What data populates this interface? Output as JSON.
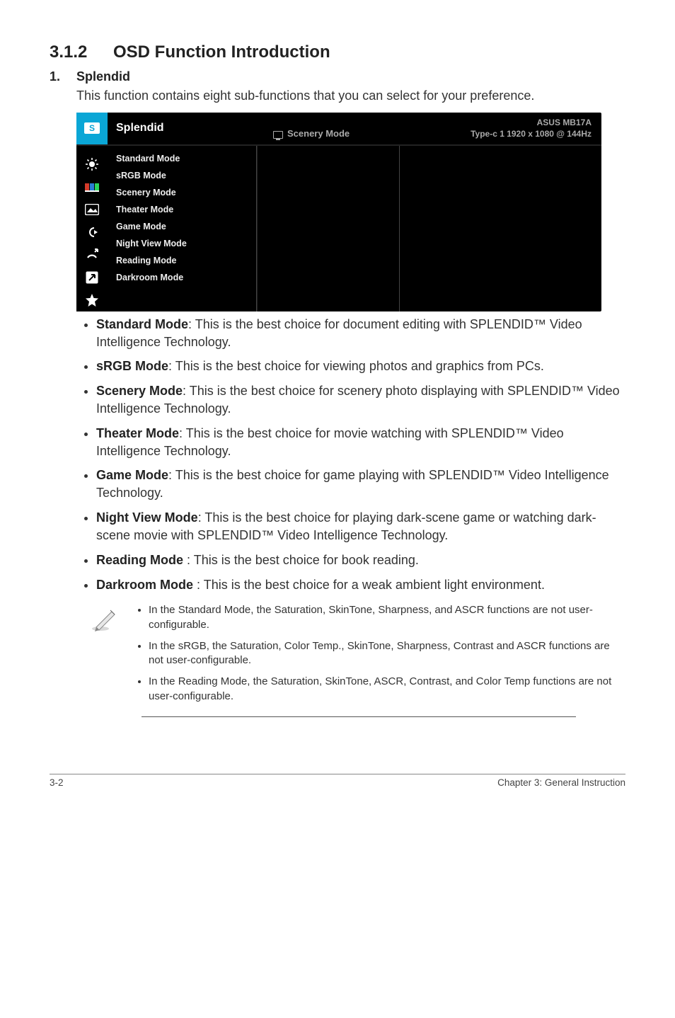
{
  "heading": {
    "number": "3.1.2",
    "title": "OSD Function Introduction"
  },
  "item": {
    "number": "1.",
    "title": "Splendid",
    "desc": "This function contains eight sub-functions that you can select for your preference."
  },
  "osd": {
    "headerTitle": "Splendid",
    "headerMode": "Scenery Mode",
    "infoLine1": "ASUS MB17A",
    "infoLine2": "Type-c 1  1920 x 1080 @ 144Hz",
    "sBadge": "S",
    "rows": [
      "Standard Mode",
      "sRGB Mode",
      "Scenery Mode",
      "Theater Mode",
      "Game Mode",
      "Night View Mode",
      "Reading Mode",
      "Darkroom Mode"
    ]
  },
  "bullets": [
    {
      "b": "Standard Mode",
      "t": ": This is the best choice for document editing with SPLENDID™ Video Intelligence Technology."
    },
    {
      "b": "sRGB Mode",
      "t": ": This is the best choice for viewing photos and graphics from PCs."
    },
    {
      "b": "Scenery Mode",
      "t": ": This is the best choice for scenery photo displaying with SPLENDID™ Video Intelligence Technology."
    },
    {
      "b": "Theater Mode",
      "t": ": This is the best choice for movie watching with SPLENDID™ Video Intelligence Technology."
    },
    {
      "b": "Game Mode",
      "t": ": This is the best choice for game playing with SPLENDID™ Video Intelligence Technology."
    },
    {
      "b": "Night View Mode",
      "t": ": This is the best choice for playing dark-scene game or watching dark-scene movie with SPLENDID™ Video Intelligence Technology."
    },
    {
      "b": "Reading Mode",
      "t": " : This is the best choice for book reading."
    },
    {
      "b": "Darkroom Mode",
      "t": " : This is the best choice for a weak ambient light environment."
    }
  ],
  "notes": [
    "In the Standard Mode, the Saturation, SkinTone, Sharpness, and ASCR functions are not user-configurable.",
    "In the sRGB, the Saturation, Color Temp., SkinTone, Sharpness, Contrast and ASCR functions are not user-configurable.",
    "In the Reading Mode, the Saturation, SkinTone, ASCR, Contrast, and Color Temp functions are not user-configurable."
  ],
  "footer": {
    "left": "3-2",
    "right": "Chapter 3: General Instruction"
  }
}
